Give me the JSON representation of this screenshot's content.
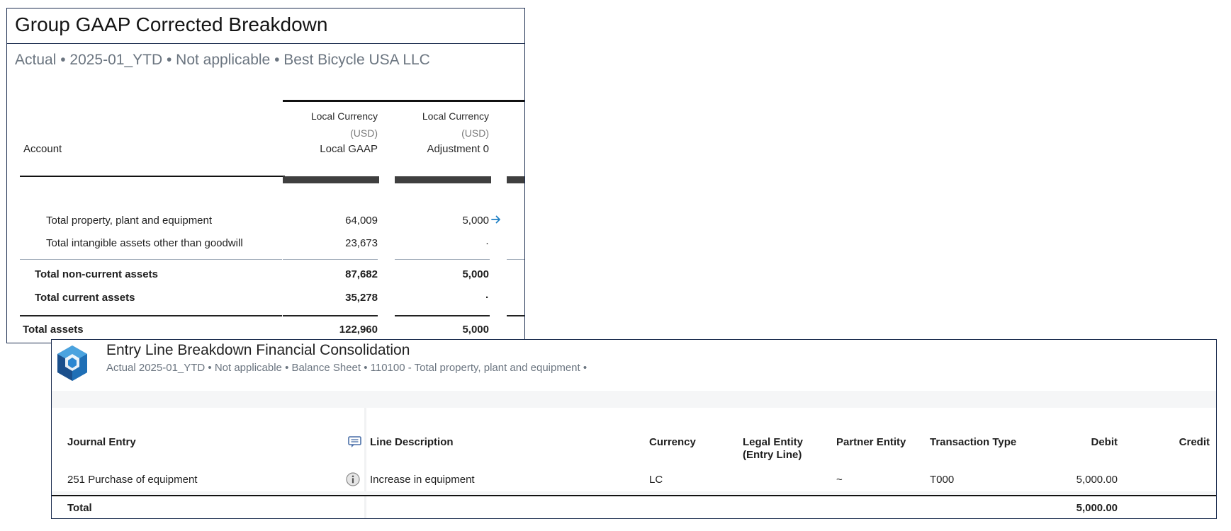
{
  "gaap_panel": {
    "title": "Group GAAP Corrected Breakdown",
    "subtitle": "Actual • 2025-01_YTD • Not applicable • Best Bicycle USA LLC",
    "account_header": "Account",
    "columns": [
      {
        "currency": "Local Currency",
        "unit": "(USD)",
        "name": "Local GAAP"
      },
      {
        "currency": "Local Currency",
        "unit": "(USD)",
        "name": "Adjustment 0"
      }
    ],
    "rows": [
      {
        "label": "Total property, plant and equipment",
        "local_gaap": "64,009",
        "adjustment": "5,000",
        "drilldown_icon": "arrow-right-icon"
      },
      {
        "label": "Total intangible assets other than goodwill",
        "local_gaap": "23,673",
        "adjustment": "·"
      },
      {
        "label": "Total non-current assets",
        "local_gaap": "87,682",
        "adjustment": "5,000"
      },
      {
        "label": "Total current assets",
        "local_gaap": "35,278",
        "adjustment": "·"
      },
      {
        "label": "Total assets",
        "local_gaap": "122,960",
        "adjustment": "5,000"
      }
    ]
  },
  "entry_panel": {
    "logo_icon": "hexagon-cube-logo-icon",
    "title": "Entry Line Breakdown Financial Consolidation",
    "subtitle": "Actual 2025-01_YTD • Not applicable • Balance Sheet • 110100 - Total property, plant and equipment •",
    "headers": {
      "journal_entry": "Journal Entry",
      "line_description": "Line Description",
      "currency": "Currency",
      "legal_entity_1": "Legal Entity",
      "legal_entity_2": "(Entry Line)",
      "partner_entity": "Partner Entity",
      "transaction_type": "Transaction Type",
      "debit": "Debit",
      "credit": "Credit"
    },
    "row": {
      "journal_entry": "251 Purchase of equipment",
      "line_description": "Increase in equipment",
      "currency": "LC",
      "legal_entity": "",
      "partner_entity": "~",
      "transaction_type": "T000",
      "debit": "5,000.00",
      "credit": ""
    },
    "total": {
      "label": "Total",
      "debit": "5,000.00"
    },
    "colors": {
      "accent": "#1e7fc4",
      "logo_dark": "#1a4f8c",
      "logo_light": "#4aa3df",
      "border": "#1c2d4f"
    }
  }
}
